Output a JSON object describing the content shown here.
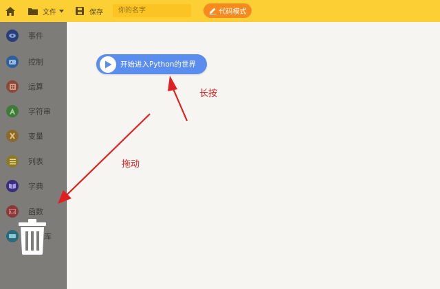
{
  "toolbar": {
    "file_label": "文件",
    "save_label": "保存",
    "name_placeholder": "你的名字",
    "code_mode_label": "代码模式"
  },
  "sidebar": {
    "items": [
      {
        "label": "事件",
        "icon": "eye-icon",
        "color": "#2a3f7a"
      },
      {
        "label": "控制",
        "icon": "gamepad-icon",
        "color": "#2f5f9a"
      },
      {
        "label": "运算",
        "icon": "calculator-icon",
        "color": "#8a4a3a"
      },
      {
        "label": "字符串",
        "icon": "letter-a-icon",
        "color": "#3f7a3a"
      },
      {
        "label": "变量",
        "icon": "variable-icon",
        "color": "#8a6a2a"
      },
      {
        "label": "列表",
        "icon": "list-icon",
        "color": "#8a7a2a"
      },
      {
        "label": "字典",
        "icon": "book-icon",
        "color": "#3a2f7a"
      },
      {
        "label": "函数",
        "icon": "function-icon",
        "color": "#8a3a3a"
      },
      {
        "label": "库",
        "icon": "library-icon",
        "color": "#2a6a7a"
      }
    ]
  },
  "canvas": {
    "block_label": "开始进入Python的世界",
    "annotation_long_press": "长按",
    "annotation_drag": "拖动"
  },
  "colors": {
    "topbar": "#fcd035",
    "accent_button": "#f78a1e",
    "block": "#5b8def",
    "annotation": "#d32424"
  }
}
